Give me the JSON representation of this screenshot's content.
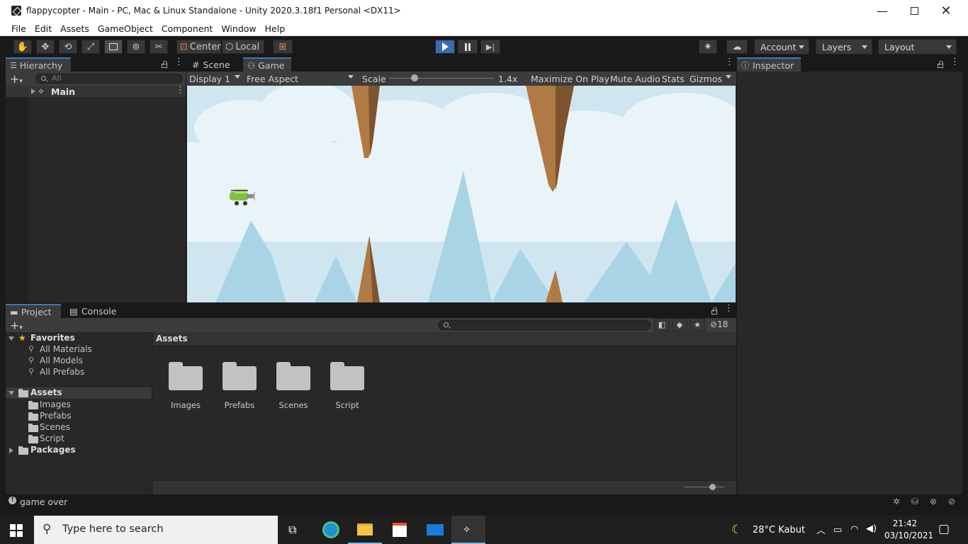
{
  "window": {
    "title": "flappycopter - Main - PC, Mac & Linux Standalone - Unity 2020.3.18f1 Personal <DX11>",
    "minimize_icon": "minimize-icon",
    "maximize_icon": "maximize-icon",
    "close_icon": "close-icon"
  },
  "menu": [
    "File",
    "Edit",
    "Assets",
    "GameObject",
    "Component",
    "Window",
    "Help"
  ],
  "toolbar": {
    "tools": [
      "hand-tool-icon",
      "move-tool-icon",
      "rotate-tool-icon",
      "scale-tool-icon",
      "rect-tool-icon",
      "transform-tool-icon",
      "custom-tool-icon"
    ],
    "pivot": "Center",
    "space": "Local",
    "account": "Account",
    "layers": "Layers",
    "layout": "Layout",
    "play_active": true
  },
  "hierarchy": {
    "tab": "Hierarchy",
    "search_placeholder": "All",
    "items": [
      {
        "label": "Main"
      }
    ]
  },
  "scene_tabs": {
    "scene": "Scene",
    "game": "Game"
  },
  "game_toolbar": {
    "display": "Display 1",
    "aspect": "Free Aspect",
    "scale_label": "Scale",
    "scale_value": "1.4x",
    "scale_slider_fraction": 0.24,
    "maximize": "Maximize On Play",
    "mute": "Mute Audio",
    "stats": "Stats",
    "gizmos": "Gizmos"
  },
  "inspector": {
    "tab": "Inspector"
  },
  "project": {
    "tab_project": "Project",
    "tab_console": "Console",
    "hidden_count": "18",
    "favorites": {
      "label": "Favorites",
      "items": [
        "All Materials",
        "All Models",
        "All Prefabs"
      ]
    },
    "assets_tree": {
      "label": "Assets",
      "items": [
        "Images",
        "Prefabs",
        "Scenes",
        "Script"
      ]
    },
    "packages": "Packages",
    "breadcrumb": "Assets",
    "folders": [
      "Images",
      "Prefabs",
      "Scenes",
      "Script"
    ]
  },
  "status": {
    "message": "game over"
  },
  "taskbar": {
    "search_placeholder": "Type here to search",
    "weather": "28°C  Kabut",
    "time": "21:42",
    "date": "03/10/2021"
  },
  "colors": {
    "accent": "#3a79bb",
    "play_blue": "#3a6bb0",
    "sky": "#cfe6f1",
    "rock": "#b07a44"
  }
}
